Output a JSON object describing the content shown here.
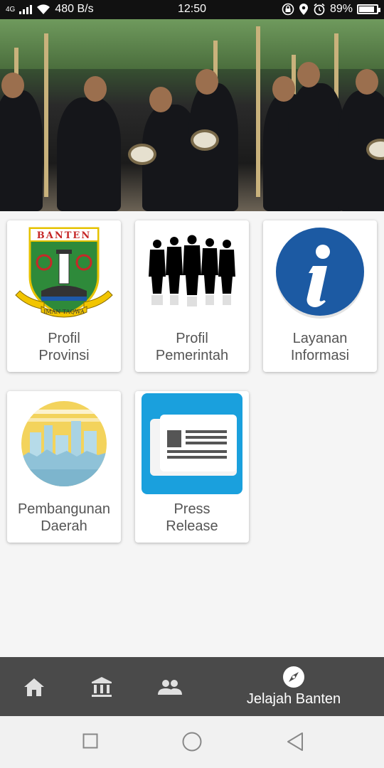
{
  "status_bar": {
    "network_type": "4G",
    "speed": "480 B/s",
    "time": "12:50",
    "battery_percent": "89%",
    "battery_level": 0.89
  },
  "banner": {
    "alt": "Traditional Banten angklung music performers"
  },
  "menu": {
    "items": [
      {
        "line1": "Profil",
        "line2": "Provinsi",
        "icon": "banten-emblem-icon"
      },
      {
        "line1": "Profil",
        "line2": "Pemerintah",
        "icon": "officials-silhouette-icon"
      },
      {
        "line1": "Layanan",
        "line2": "Informasi",
        "icon": "info-icon"
      },
      {
        "line1": "Pembangunan",
        "line2": "Daerah",
        "icon": "city-development-icon"
      },
      {
        "line1": "Press",
        "line2": "Release",
        "icon": "newspaper-icon"
      }
    ],
    "emblem_text": "BANTEN",
    "emblem_motto": "IMAN TAQWA"
  },
  "bottom_nav": {
    "items": [
      {
        "icon": "home-icon",
        "label": ""
      },
      {
        "icon": "institution-icon",
        "label": ""
      },
      {
        "icon": "people-icon",
        "label": ""
      },
      {
        "icon": "compass-icon",
        "label": "Jelajah Banten"
      }
    ],
    "colors": {
      "background": "#4a4a4a",
      "active": "#ffffff",
      "inactive": "#e0e0e0"
    }
  },
  "system_nav": {
    "buttons": [
      "recent-apps",
      "home",
      "back"
    ]
  }
}
